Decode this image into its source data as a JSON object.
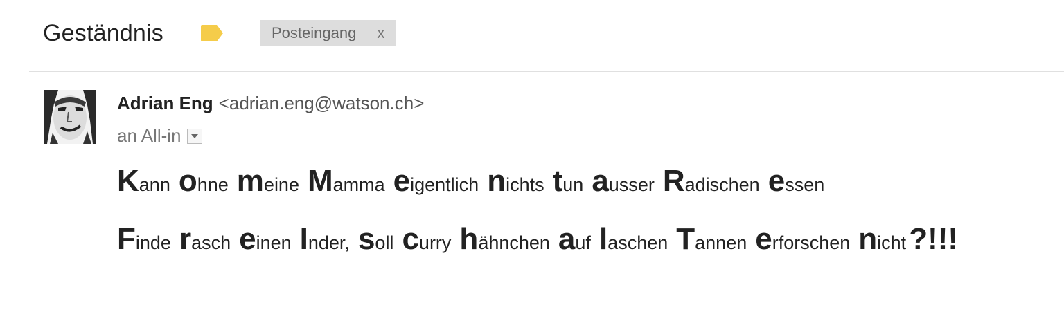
{
  "email": {
    "subject": "Geständnis",
    "label_icon": "label-tag-icon",
    "label_color": "#f5cc4a",
    "label_chip": "Posteingang",
    "label_chip_close": "x",
    "sender_name": "Adrian Eng",
    "sender_email": "<adrian.eng@watson.ch>",
    "to_text": "an All-in",
    "to_dropdown_icon": "dropdown-arrow-icon",
    "avatar_icon": "sender-avatar"
  },
  "body": {
    "line1": [
      {
        "big": "K",
        "rest": "ann"
      },
      {
        "big": "o",
        "rest": "hne"
      },
      {
        "big": "m",
        "rest": "eine"
      },
      {
        "big": "M",
        "rest": "amma"
      },
      {
        "big": "e",
        "rest": "igentlich"
      },
      {
        "big": "n",
        "rest": "ichts"
      },
      {
        "big": "t",
        "rest": "un"
      },
      {
        "big": "a",
        "rest": "usser"
      },
      {
        "big": "R",
        "rest": "adischen"
      },
      {
        "big": "e",
        "rest": "ssen"
      }
    ],
    "line2": [
      {
        "big": "F",
        "rest": "inde"
      },
      {
        "big": "r",
        "rest": "asch"
      },
      {
        "big": "e",
        "rest": "inen"
      },
      {
        "big": "I",
        "rest": "nder,"
      },
      {
        "big": "s",
        "rest": "oll"
      },
      {
        "big": "c",
        "rest": "urry"
      },
      {
        "big": "h",
        "rest": "ähnchen"
      },
      {
        "big": "a",
        "rest": "uf"
      },
      {
        "big": "l",
        "rest": "aschen"
      },
      {
        "big": "T",
        "rest": "annen"
      },
      {
        "big": "e",
        "rest": "rforschen"
      },
      {
        "big": "n",
        "rest": "icht"
      },
      {
        "big": "?!!!",
        "rest": ""
      }
    ]
  }
}
